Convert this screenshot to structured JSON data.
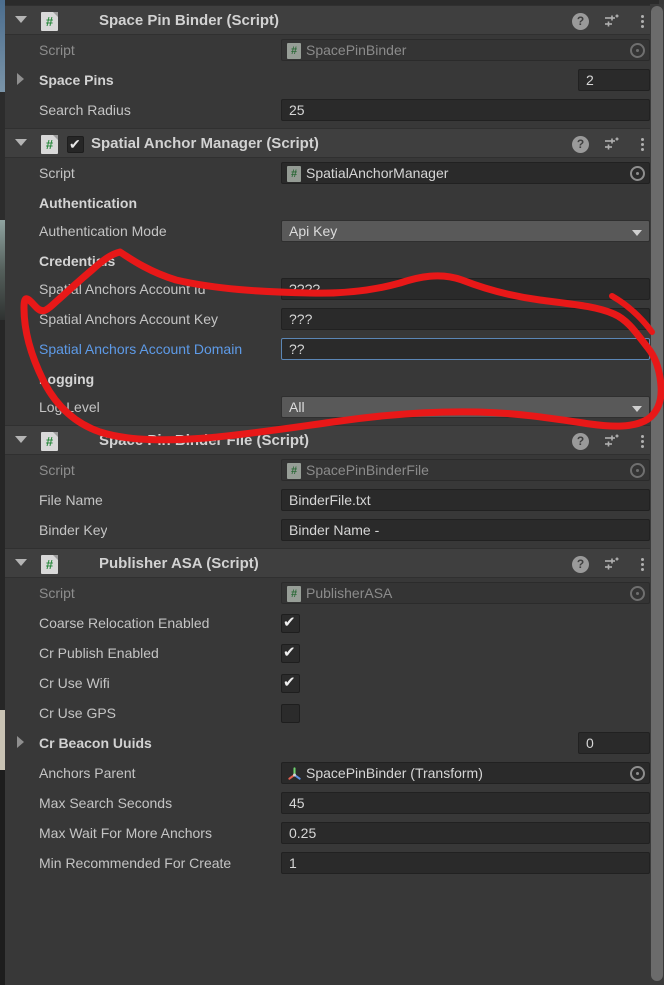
{
  "app": {
    "panel": "Unity Inspector",
    "colors": {
      "panel_bg": "#383838",
      "header_bg": "#3f3f3f",
      "field_bg": "#2a2a2a",
      "dropdown_bg": "#595959",
      "label": "#c4c4c4",
      "label_dim": "#8d8d8d",
      "label_highlight_blue": "#5e9be8",
      "focus_border": "#5b86b5",
      "annotation_red": "#e81818",
      "script_icon_green": "#2a8a3e"
    },
    "header_icons": [
      {
        "name": "help-icon",
        "glyph": "?"
      },
      {
        "name": "preset-icon",
        "glyph": "presets"
      },
      {
        "name": "more-menu-icon",
        "glyph": "⋮"
      }
    ]
  },
  "annotation": {
    "type": "freehand-ink-circle",
    "color": "#e81818",
    "encircles": "Credentials group: Spatial Anchors Account Id / Key / Domain fields"
  },
  "components": [
    {
      "id": "space-pin-binder",
      "title": "Space Pin Binder (Script)",
      "expanded": true,
      "has_enable_checkbox": false,
      "rows": [
        {
          "kind": "object-ref",
          "label": "Script",
          "label_style": "dim",
          "value": "SpacePinBinder",
          "value_style": "dim",
          "icon": "script-icon",
          "picker": true
        },
        {
          "kind": "array-size",
          "label": "Space Pins",
          "label_style": "bold",
          "foldout": "closed",
          "value": "2"
        },
        {
          "kind": "text",
          "label": "Search Radius",
          "value": "25"
        }
      ]
    },
    {
      "id": "spatial-anchor-manager",
      "title": "Spatial Anchor Manager (Script)",
      "expanded": true,
      "has_enable_checkbox": true,
      "enabled": true,
      "rows": [
        {
          "kind": "object-ref",
          "label": "Script",
          "value": "SpatialAnchorManager",
          "icon": "script-icon",
          "picker": true
        },
        {
          "kind": "group-header",
          "label": "Authentication"
        },
        {
          "kind": "dropdown",
          "label": "Authentication Mode",
          "value": "Api Key"
        },
        {
          "kind": "group-header",
          "label": "Credentials"
        },
        {
          "kind": "text",
          "label": "Spatial Anchors Account Id",
          "value": "????"
        },
        {
          "kind": "text",
          "label": "Spatial Anchors Account Key",
          "value": "???"
        },
        {
          "kind": "text",
          "label": "Spatial Anchors Account Domain",
          "label_style": "blue",
          "value": "??",
          "focused": true
        },
        {
          "kind": "group-header",
          "label": "Logging"
        },
        {
          "kind": "dropdown",
          "label": "Log Level",
          "value": "All"
        }
      ]
    },
    {
      "id": "space-pin-binder-file",
      "title": "Space Pin Binder File (Script)",
      "expanded": true,
      "has_enable_checkbox": false,
      "rows": [
        {
          "kind": "object-ref",
          "label": "Script",
          "label_style": "dim",
          "value": "SpacePinBinderFile",
          "value_style": "dim",
          "icon": "script-icon",
          "picker": true
        },
        {
          "kind": "text",
          "label": "File Name",
          "value": "BinderFile.txt"
        },
        {
          "kind": "text",
          "label": "Binder Key",
          "value": "Binder Name -"
        }
      ]
    },
    {
      "id": "publisher-asa",
      "title": "Publisher ASA (Script)",
      "expanded": true,
      "has_enable_checkbox": false,
      "rows": [
        {
          "kind": "object-ref",
          "label": "Script",
          "label_style": "dim",
          "value": "PublisherASA",
          "value_style": "dim",
          "icon": "script-icon",
          "picker": true
        },
        {
          "kind": "checkbox",
          "label": "Coarse Relocation Enabled",
          "checked": true
        },
        {
          "kind": "checkbox",
          "label": "Cr Publish Enabled",
          "checked": true
        },
        {
          "kind": "checkbox",
          "label": "Cr Use Wifi",
          "checked": true
        },
        {
          "kind": "checkbox",
          "label": "Cr Use GPS",
          "checked": false
        },
        {
          "kind": "array-size",
          "label": "Cr Beacon Uuids",
          "label_style": "bold",
          "foldout": "closed",
          "value": "0"
        },
        {
          "kind": "object-ref",
          "label": "Anchors Parent",
          "value": "SpacePinBinder (Transform)",
          "icon": "transform-icon",
          "picker": true
        },
        {
          "kind": "text",
          "label": "Max Search Seconds",
          "value": "45"
        },
        {
          "kind": "text",
          "label": "Max Wait For More Anchors",
          "value": "0.25"
        },
        {
          "kind": "text",
          "label": "Min Recommended For Create",
          "value": "1"
        }
      ]
    }
  ]
}
